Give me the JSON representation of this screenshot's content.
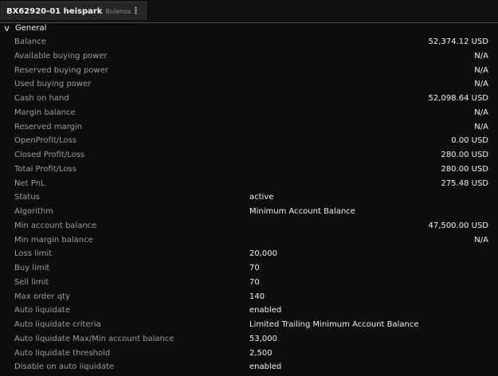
{
  "tab": {
    "title": "BX62920-01 heispark",
    "subtitle": "Bulenox",
    "menu_icon": "kebab-menu-icon"
  },
  "section": {
    "label": "General",
    "expand_icon": "chevron-down-icon"
  },
  "rows": [
    {
      "label": "Balance",
      "text": "",
      "value": "52,374.12 USD"
    },
    {
      "label": "Available buying power",
      "text": "",
      "value": "N/A"
    },
    {
      "label": "Reserved buying power",
      "text": "",
      "value": "N/A"
    },
    {
      "label": "Used buying power",
      "text": "",
      "value": "N/A"
    },
    {
      "label": "Cash on hand",
      "text": "",
      "value": "52,098.64 USD"
    },
    {
      "label": "Margin balance",
      "text": "",
      "value": "N/A"
    },
    {
      "label": "Reserved margin",
      "text": "",
      "value": "N/A"
    },
    {
      "label": "OpenProfit/Loss",
      "text": "",
      "value": "0.00 USD"
    },
    {
      "label": "Closed Profit/Loss",
      "text": "",
      "value": "280.00 USD"
    },
    {
      "label": "Total Profit/Loss",
      "text": "",
      "value": "280.00 USD"
    },
    {
      "label": "Net PnL",
      "text": "",
      "value": "275.48 USD"
    },
    {
      "label": "Status",
      "text": "active",
      "value": ""
    },
    {
      "label": "Algorithm",
      "text": "Minimum Account Balance",
      "value": ""
    },
    {
      "label": "Min account balance",
      "text": "",
      "value": "47,500.00 USD"
    },
    {
      "label": "Min margin balance",
      "text": "",
      "value": "N/A"
    },
    {
      "label": "Loss limit",
      "text": "20,000",
      "value": ""
    },
    {
      "label": "Buy limit",
      "text": "70",
      "value": ""
    },
    {
      "label": "Sell limit",
      "text": "70",
      "value": ""
    },
    {
      "label": "Max order qty",
      "text": "140",
      "value": ""
    },
    {
      "label": "Auto liquidate",
      "text": "enabled",
      "value": ""
    },
    {
      "label": "Auto liquidate criteria",
      "text": "Limited Trailing Minimum Account Balance",
      "value": ""
    },
    {
      "label": "Auto liquidate Max/Min account balance",
      "text": "53,000",
      "value": ""
    },
    {
      "label": "Auto liquidate threshold",
      "text": "2,500",
      "value": ""
    },
    {
      "label": "Disable on auto liquidate",
      "text": "enabled",
      "value": ""
    }
  ]
}
